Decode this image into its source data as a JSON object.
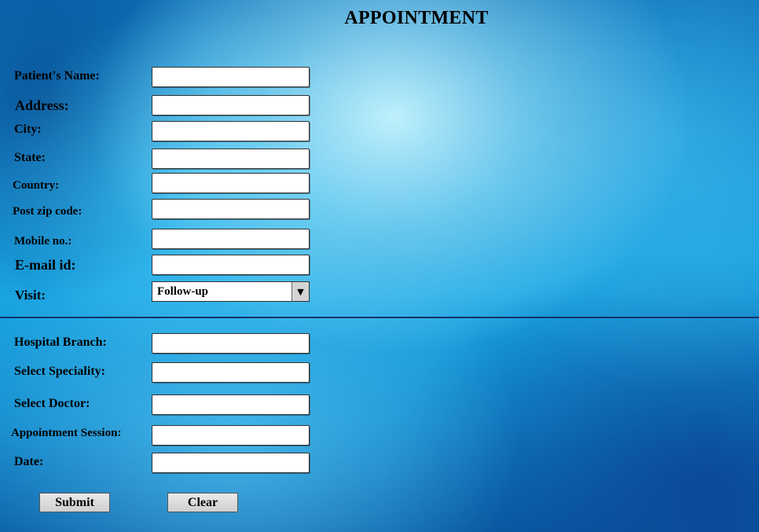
{
  "page": {
    "title": "APPOINTMENT"
  },
  "patient_section": {
    "fields": [
      {
        "label": "Patient's Name:",
        "value": ""
      },
      {
        "label": "Address:",
        "value": ""
      },
      {
        "label": "City:",
        "value": ""
      },
      {
        "label": "State:",
        "value": ""
      },
      {
        "label": "Country:",
        "value": ""
      },
      {
        "label": "Post zip code:",
        "value": ""
      },
      {
        "label": "Mobile no.:",
        "value": ""
      },
      {
        "label": "E-mail id:",
        "value": ""
      }
    ],
    "visit": {
      "label": "Visit:",
      "selected": "Follow-up"
    }
  },
  "hospital_section": {
    "fields": [
      {
        "label": "Hospital Branch:",
        "value": ""
      },
      {
        "label": "Select Speciality:",
        "value": ""
      },
      {
        "label": "Select Doctor:",
        "value": ""
      },
      {
        "label": "Appointment Session:",
        "value": ""
      },
      {
        "label": "Date:",
        "value": ""
      }
    ]
  },
  "actions": {
    "submit_label": "Submit",
    "clear_label": "Clear"
  },
  "icons": {
    "dropdown": "chevron-down-icon"
  }
}
